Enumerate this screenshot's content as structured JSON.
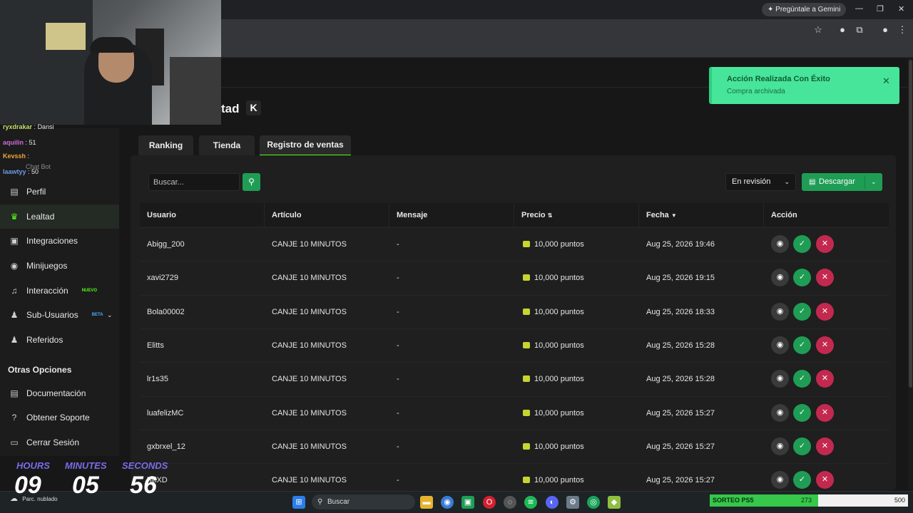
{
  "browser": {
    "gemini_label": "Pregúntale a Gemini"
  },
  "page": {
    "title": "tad",
    "title_logo": "K"
  },
  "chat": [
    {
      "user": "ryxdrakar",
      "message": "Dansi",
      "color": "#c6e06a"
    },
    {
      "user": "aquilin",
      "message": "51",
      "color": "#d16ad9"
    },
    {
      "user": "Kevssh",
      "message": "",
      "color": "#f2a535"
    },
    {
      "user": "Chat Bot",
      "message": "",
      "color": "#8a8a8a"
    },
    {
      "user": "laawtyy",
      "message": "50",
      "color": "#6a9be0"
    }
  ],
  "sidebar": {
    "items": [
      {
        "label": "Perfil",
        "icon": "id-card-icon"
      },
      {
        "label": "Lealtad",
        "icon": "trophy-icon",
        "active": true
      },
      {
        "label": "Integraciones",
        "icon": "plug-icon"
      },
      {
        "label": "Minijuegos",
        "icon": "gamepad-icon"
      },
      {
        "label": "Interacción",
        "icon": "music-icon",
        "badge": "NUEVO"
      },
      {
        "label": "Sub-Usuarios",
        "icon": "users-icon",
        "badge": "BETA"
      },
      {
        "label": "Referidos",
        "icon": "user-group-icon"
      }
    ],
    "section_title": "Otras Opciones",
    "other_items": [
      {
        "label": "Documentación",
        "icon": "document-icon"
      },
      {
        "label": "Obtener Soporte",
        "icon": "help-icon"
      },
      {
        "label": "Cerrar Sesión",
        "icon": "logout-icon"
      }
    ]
  },
  "tabs": [
    {
      "label": "Ranking"
    },
    {
      "label": "Tienda"
    },
    {
      "label": "Registro de ventas",
      "active": true
    }
  ],
  "toolbar": {
    "search_placeholder": "Buscar...",
    "status_value": "En revisión",
    "download_label": "Descargar"
  },
  "table": {
    "headers": [
      "Usuario",
      "Artículo",
      "Mensaje",
      "Precio",
      "Fecha",
      "Acción"
    ],
    "rows": [
      {
        "usuario": "Abigg_200",
        "articulo": "CANJE 10 MINUTOS",
        "mensaje": "-",
        "precio": "10,000 puntos",
        "fecha": "Aug 25, 2026 19:46"
      },
      {
        "usuario": "xavi2729",
        "articulo": "CANJE 10 MINUTOS",
        "mensaje": "-",
        "precio": "10,000 puntos",
        "fecha": "Aug 25, 2026 19:15"
      },
      {
        "usuario": "Bola00002",
        "articulo": "CANJE 10 MINUTOS",
        "mensaje": "-",
        "precio": "10,000 puntos",
        "fecha": "Aug 25, 2026 18:33"
      },
      {
        "usuario": "Elitts",
        "articulo": "CANJE 10 MINUTOS",
        "mensaje": "-",
        "precio": "10,000 puntos",
        "fecha": "Aug 25, 2026 15:28"
      },
      {
        "usuario": "lr1s35",
        "articulo": "CANJE 10 MINUTOS",
        "mensaje": "-",
        "precio": "10,000 puntos",
        "fecha": "Aug 25, 2026 15:28"
      },
      {
        "usuario": "luafelizMC",
        "articulo": "CANJE 10 MINUTOS",
        "mensaje": "-",
        "precio": "10,000 puntos",
        "fecha": "Aug 25, 2026 15:27"
      },
      {
        "usuario": "gxbrxel_12",
        "articulo": "CANJE 10 MINUTOS",
        "mensaje": "-",
        "precio": "10,000 puntos",
        "fecha": "Aug 25, 2026 15:27"
      },
      {
        "usuario": "hiiiXD",
        "articulo": "CANJE 10 MINUTOS",
        "mensaje": "-",
        "precio": "10,000 puntos",
        "fecha": "Aug 25, 2026 15:27"
      }
    ]
  },
  "toast": {
    "title": "Acción Realizada Con Éxito",
    "message": "Compra archivada"
  },
  "timer": {
    "hours_label": "HOURS",
    "minutes_label": "MINUTES",
    "seconds_label": "SECONDS",
    "hours": "09",
    "minutes": "05",
    "seconds": "56"
  },
  "taskbar": {
    "search_label": "Buscar",
    "weather_condition": "Parc. nublado"
  },
  "goal": {
    "label": "SORTEO PS5",
    "current": "273",
    "max": "500",
    "progress": 0.546
  },
  "colors": {
    "accent": "#53fc18",
    "success": "#1f9d55",
    "danger": "#c3294f",
    "toast_bg": "#47e59a"
  }
}
